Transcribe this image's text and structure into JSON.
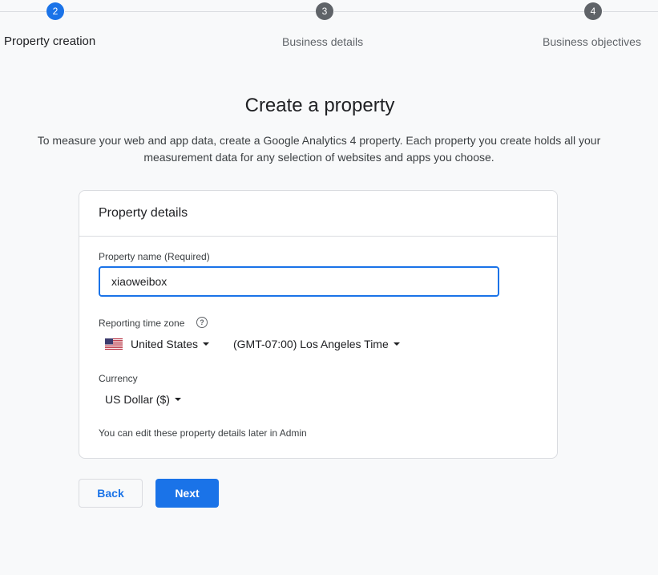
{
  "stepper": {
    "steps": [
      {
        "number": "2",
        "label": "Property creation",
        "active": true
      },
      {
        "number": "3",
        "label": "Business details",
        "active": false
      },
      {
        "number": "4",
        "label": "Business objectives",
        "active": false
      }
    ]
  },
  "page": {
    "title": "Create a property",
    "intro_line1": "To measure your web and app data, create a Google Analytics 4 property. Each property you create holds all your",
    "intro_line2": "measurement data for any selection of websites and apps you choose."
  },
  "card": {
    "title": "Property details",
    "property_name_label": "Property name (Required)",
    "property_name_value": "xiaoweibox",
    "timezone_label": "Reporting time zone",
    "help_icon": "help-circle-icon",
    "country_flag_icon": "us-flag-icon",
    "country_value": "United States",
    "timezone_value": "(GMT-07:00) Los Angeles Time",
    "currency_label": "Currency",
    "currency_value": "US Dollar ($)",
    "note": "You can edit these property details later in Admin"
  },
  "buttons": {
    "back_label": "Back",
    "next_label": "Next"
  },
  "colors": {
    "accent": "#1a73e8",
    "inactive_step": "#5f6368",
    "background": "#f8f9fa",
    "border": "#dadce0"
  }
}
